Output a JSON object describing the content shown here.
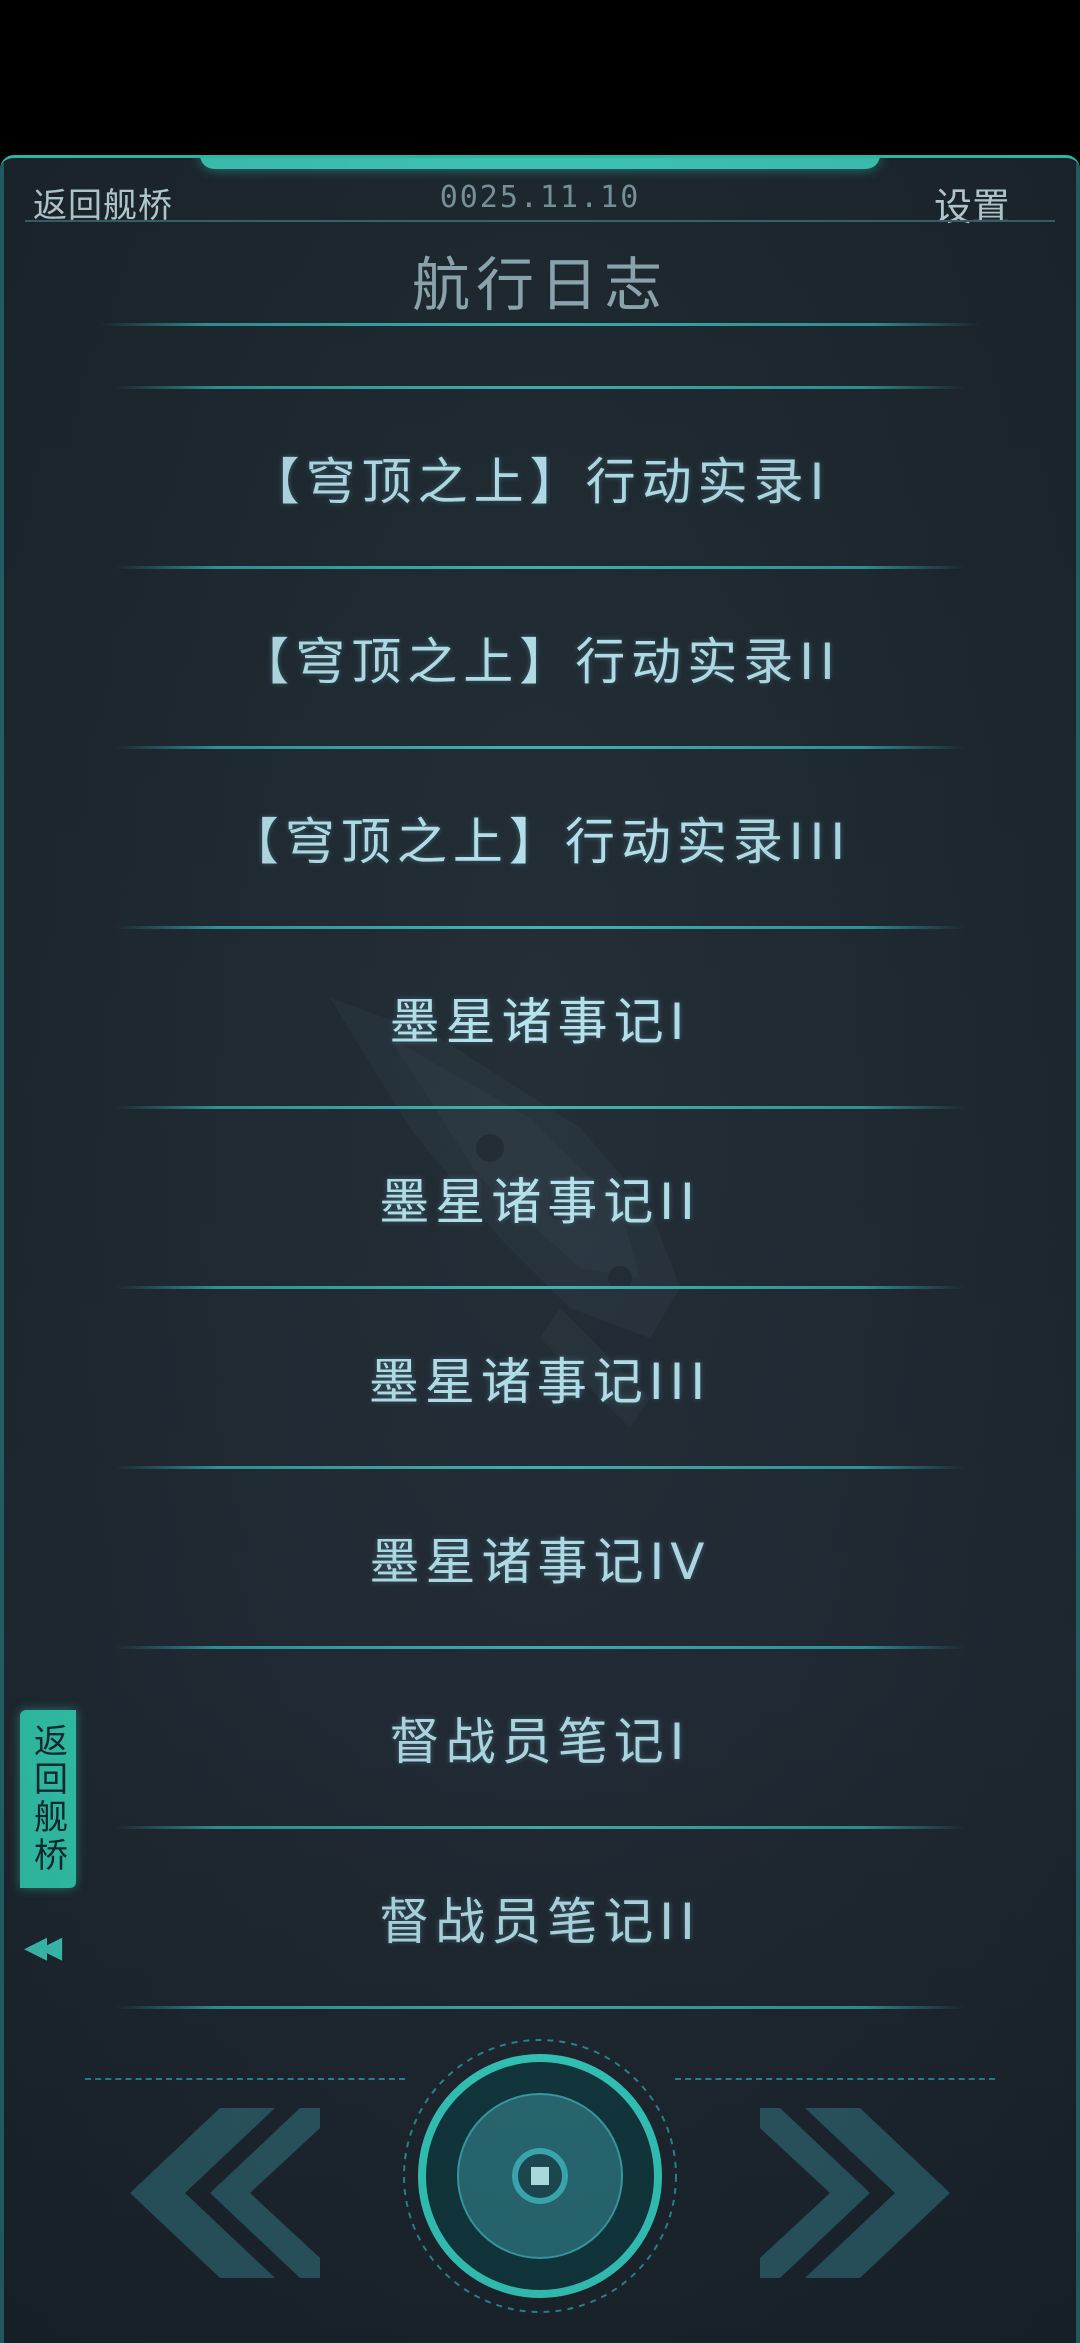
{
  "header": {
    "back_label": "返回舰桥",
    "date": "0025.11.10",
    "settings_label": "设置"
  },
  "page_title": "航行日志",
  "log_entries": [
    {
      "label": "【穹顶之上】行动实录I"
    },
    {
      "label": "【穹顶之上】行动实录II"
    },
    {
      "label": "【穹顶之上】行动实录III"
    },
    {
      "label": "墨星诸事记I"
    },
    {
      "label": "墨星诸事记II"
    },
    {
      "label": "墨星诸事记III"
    },
    {
      "label": "墨星诸事记IV"
    },
    {
      "label": "督战员笔记I"
    },
    {
      "label": "督战员笔记II"
    }
  ],
  "side_tab": {
    "label": "返回舰桥",
    "chevrons": "◀◀"
  },
  "controls": {
    "prev_icon": "double-chevron-left-icon",
    "next_icon": "double-chevron-right-icon",
    "center_icon": "ring-button-icon"
  },
  "colors": {
    "accent": "#3fd1bf",
    "background": "#1f2a33",
    "text": "#b6e3ee",
    "divider": "#2f9ca0",
    "arrow": "#2b5a66"
  }
}
